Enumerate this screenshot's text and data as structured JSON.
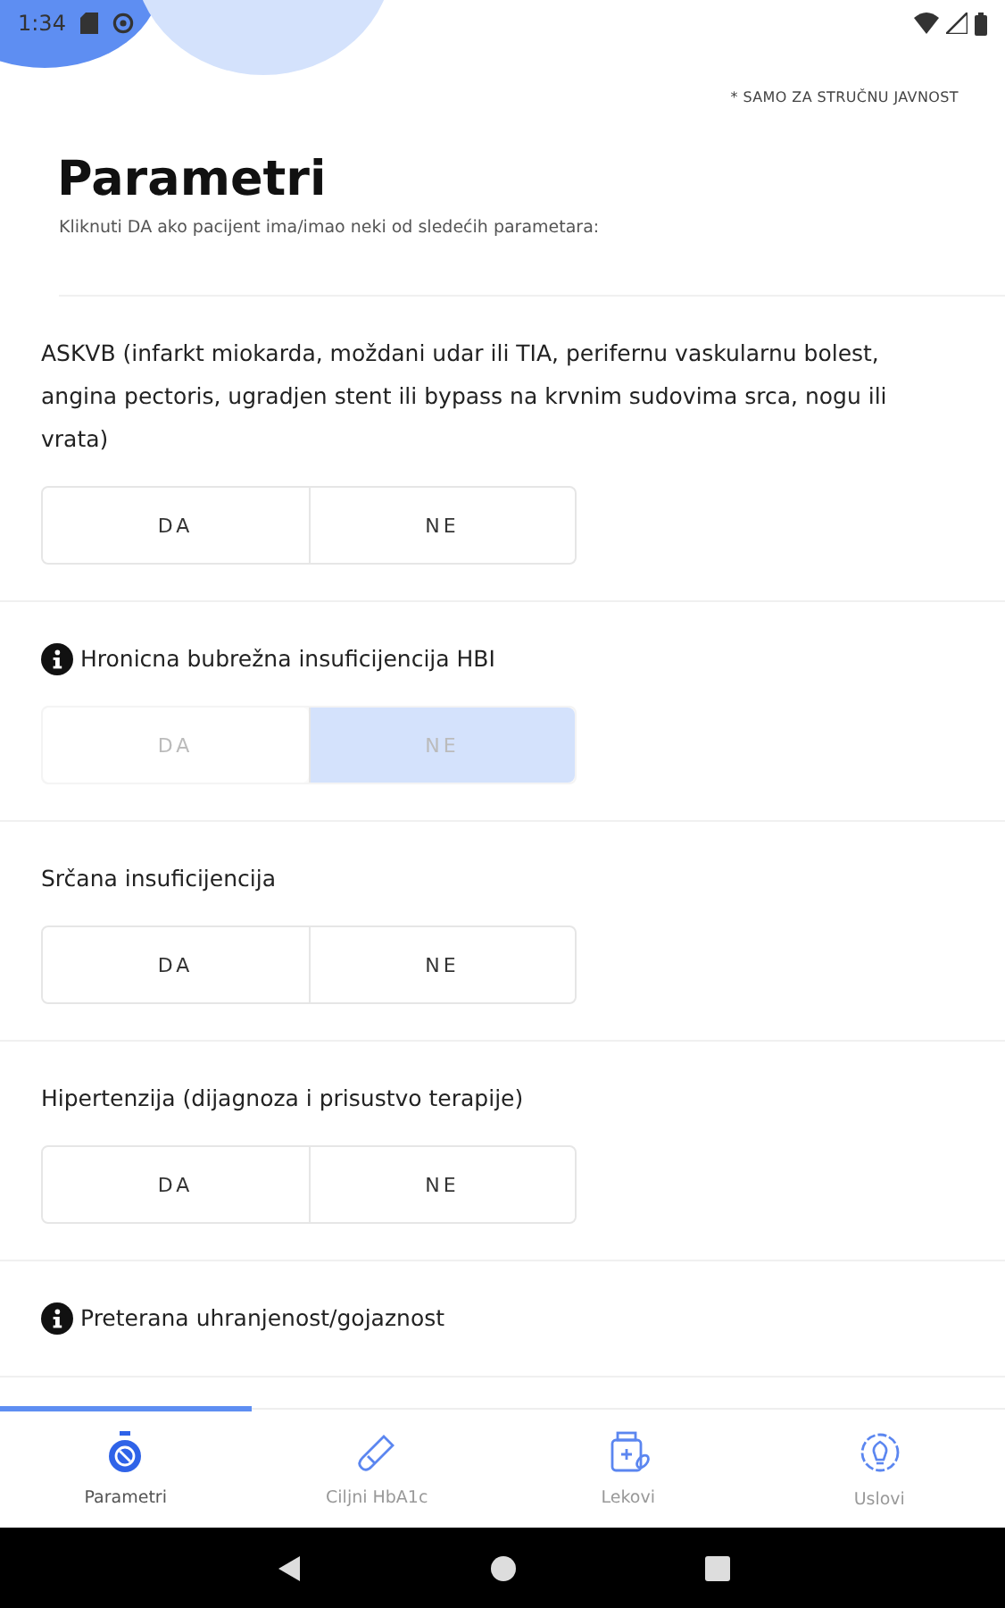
{
  "status_bar": {
    "time": "1:34"
  },
  "note": "* SAMO ZA STRUČNU JAVNOST",
  "title": "Parametri",
  "subtitle": "Kliknuti DA ako pacijent ima/imao neki od sledećih parametara:",
  "questions": [
    {
      "text": "ASKVB (infarkt miokarda, moždani udar ili TIA, perifernu vaskularnu bolest, angina pectoris, ugradjen stent ili bypass na krvnim sudovima srca, nogu ili vrata)",
      "info": false,
      "disabled": false,
      "options": [
        {
          "label": "DA",
          "selected": false
        },
        {
          "label": "NE",
          "selected": false
        }
      ]
    },
    {
      "text": "Hronicna bubrežna insuficijencija HBI",
      "info": true,
      "disabled": true,
      "options": [
        {
          "label": "DA",
          "selected": false
        },
        {
          "label": "NE",
          "selected": true
        }
      ]
    },
    {
      "text": "Srčana insuficijencija",
      "info": false,
      "disabled": false,
      "options": [
        {
          "label": "DA",
          "selected": false
        },
        {
          "label": "NE",
          "selected": false
        }
      ]
    },
    {
      "text": "Hipertenzija (dijagnoza i prisustvo terapije)",
      "info": false,
      "disabled": false,
      "options": [
        {
          "label": "DA",
          "selected": false
        },
        {
          "label": "NE",
          "selected": false
        }
      ]
    },
    {
      "text": "Preterana uhranjenost/gojaznost",
      "info": true
    }
  ],
  "tabs": [
    {
      "label": "Parametri",
      "selected": true
    },
    {
      "label": "Ciljni HbA1c",
      "selected": false
    },
    {
      "label": "Lekovi",
      "selected": false
    },
    {
      "label": "Uslovi",
      "selected": false
    }
  ]
}
